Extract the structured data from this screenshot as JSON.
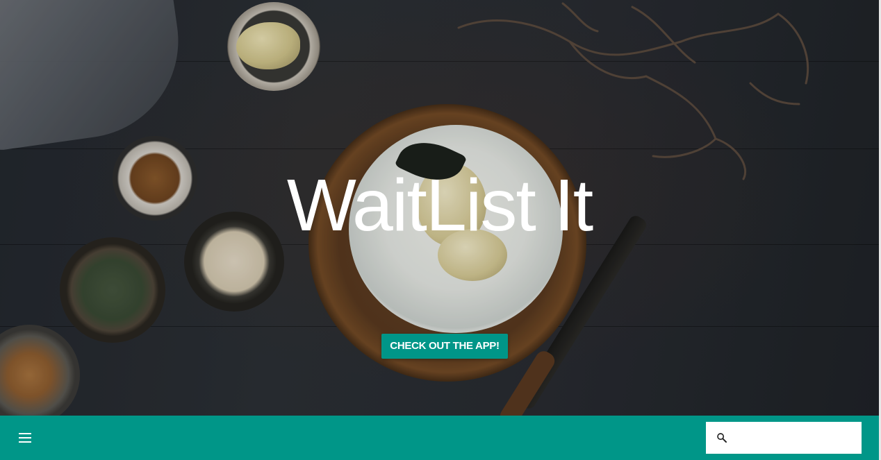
{
  "hero": {
    "title": "WaitList It",
    "cta_label": "CHECK OUT THE APP!"
  },
  "bottom_bar": {
    "menu_icon": "hamburger-menu-icon",
    "search_icon": "search-icon",
    "search_value": "",
    "search_placeholder": ""
  },
  "colors": {
    "accent": "#009688",
    "hero_text": "#ffffff",
    "search_background": "#ffffff"
  }
}
